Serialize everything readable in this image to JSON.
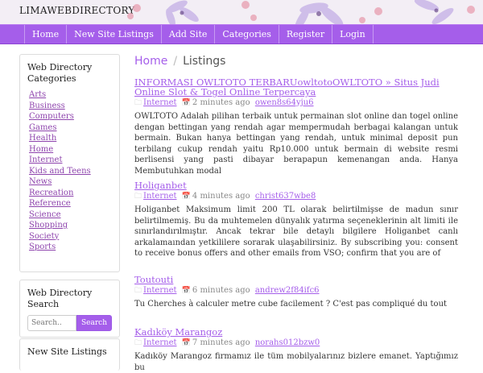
{
  "site": {
    "brand": "LIMAWEBDIRECTORY"
  },
  "nav": [
    {
      "label": "Home"
    },
    {
      "label": "New Site Listings"
    },
    {
      "label": "Add Site"
    },
    {
      "label": "Categories"
    },
    {
      "label": "Register"
    },
    {
      "label": "Login"
    }
  ],
  "sidebar": {
    "categories_title": "Web Directory Categories",
    "categories": [
      "Arts",
      "Business",
      "Computers",
      "Games",
      "Health",
      "Home",
      "Internet",
      "Kids and Teens",
      "News",
      "Recreation",
      "Reference",
      "Science",
      "Shopping",
      "Society",
      "Sports"
    ],
    "search_title": "Web Directory Search",
    "search_placeholder": "Search..",
    "search_button": "Search",
    "new_listings_title": "New Site Listings"
  },
  "breadcrumb": {
    "home": "Home",
    "separator": "/",
    "current": "Listings"
  },
  "listings": [
    {
      "title": "INFORMASI OWLTOTO TERBARUowltotoOWLTOTO » Situs Judi Online Slot & Togel Online Terpercaya",
      "category": "Internet",
      "time": "2 minutes ago",
      "user": "owen8s64yju6",
      "description": "OWLTOTO Adalah pilihan terbaik untuk permainan slot online dan togel online dengan bettingan yang rendah agar mempermudah berbagai kalangan untuk bermain. Bukan hanya bettingan yang rendah, untuk minimal deposit pun terbilang cukup rendah yaitu Rp10.000 untuk bermain di website resmi berlisensi yang pasti dibayar berapapun kemenangan anda. Hanya Membutuhkan modal"
    },
    {
      "title": "Holiganbet",
      "category": "Internet",
      "time": "4 minutes ago",
      "user": "christ637wbe8",
      "description": "Holiganbet Maksimum limit 200 TL olarak belirtilmişse de madun sınır belirtilmemiş. Bu da muhtemelen dünyalık yatırma seçeneklerinin alt limiti ile sınırlandırılmıştır. Ancak tekrar bile detaylı bilgilere Holiganbet canlı arkalamaından yetkililere sorarak ulaşabilirsiniz. By subscribing you: consent to receive bonus offers and other emails from VSO; confirm that you are of"
    },
    {
      "title": "Toutouti",
      "category": "Internet",
      "time": "6 minutes ago",
      "user": "andrew2f84ifc6",
      "description": "Tu Cherches à calculer metre cube facilement ? C'est pas compliqué du tout"
    },
    {
      "title": "Kadıköy Marangoz",
      "category": "Internet",
      "time": "7 minutes ago",
      "user": "norahs012bzw0",
      "description": "Kadıköy Marangoz firmamız ile tüm mobilyalarınız bizlere emanet. Yaptığımız bu"
    }
  ]
}
